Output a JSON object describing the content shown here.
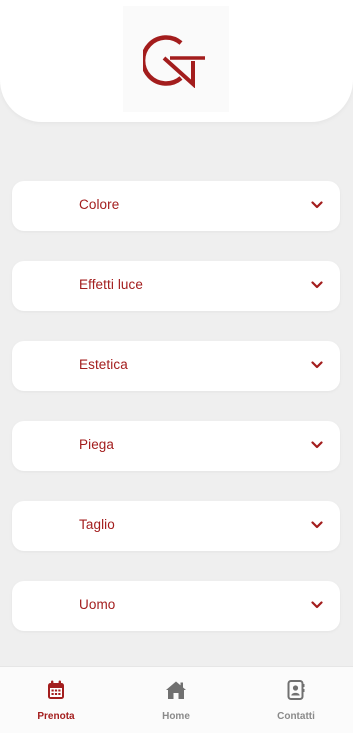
{
  "brand": {
    "accent_color": "#a31d1d",
    "logo_icon": "gn-monogram-logo"
  },
  "categories": [
    {
      "label": "Colore",
      "icon": "chevron-down-icon"
    },
    {
      "label": "Effetti luce",
      "icon": "chevron-down-icon"
    },
    {
      "label": "Estetica",
      "icon": "chevron-down-icon"
    },
    {
      "label": "Piega",
      "icon": "chevron-down-icon"
    },
    {
      "label": "Taglio",
      "icon": "chevron-down-icon"
    },
    {
      "label": "Uomo",
      "icon": "chevron-down-icon"
    }
  ],
  "bottom_nav": {
    "active": "Prenota",
    "items": [
      {
        "label": "Prenota",
        "icon": "calendar-icon"
      },
      {
        "label": "Home",
        "icon": "home-icon"
      },
      {
        "label": "Contatti",
        "icon": "contact-book-icon"
      }
    ]
  }
}
